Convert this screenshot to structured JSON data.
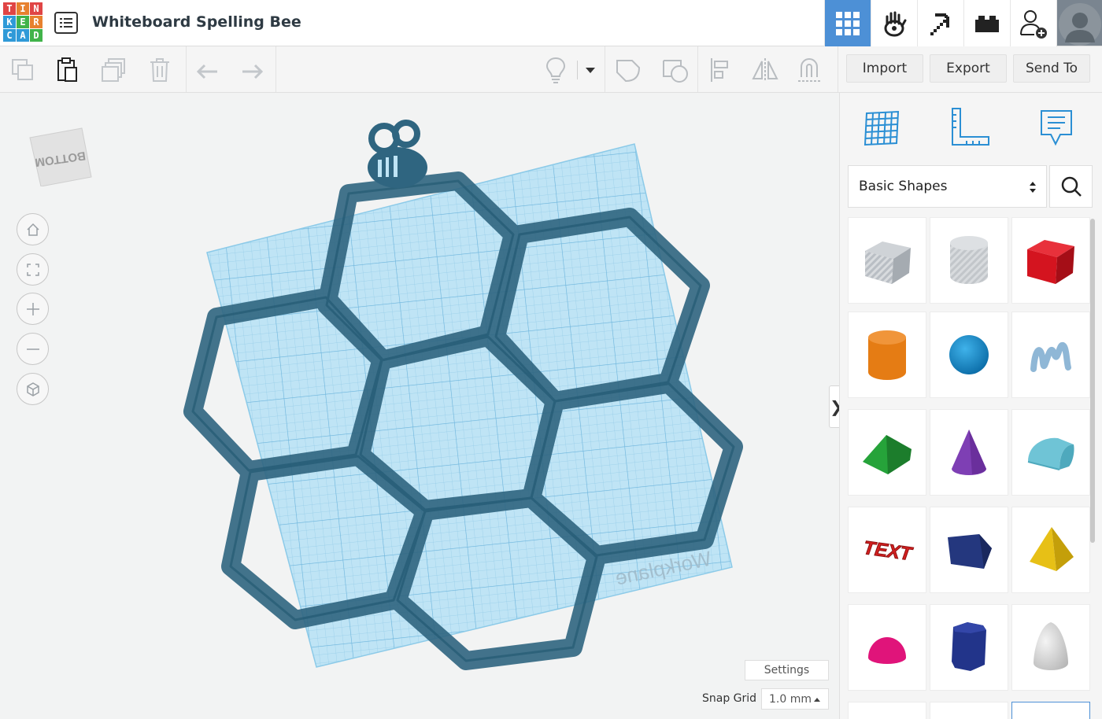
{
  "logo": {
    "letters": [
      "T",
      "I",
      "N",
      "K",
      "E",
      "R",
      "C",
      "A",
      "D"
    ]
  },
  "header": {
    "project_title": "Whiteboard Spelling Bee",
    "nav": [
      {
        "name": "3d-design",
        "icon": "grid-icon",
        "active": true
      },
      {
        "name": "circuits",
        "icon": "hand-icon",
        "active": false
      },
      {
        "name": "minecraft",
        "icon": "pickaxe-icon",
        "active": false
      },
      {
        "name": "lego-bricks",
        "icon": "brick-icon",
        "active": false
      },
      {
        "name": "invite",
        "icon": "user-add-icon",
        "active": false
      }
    ]
  },
  "toolbar": {
    "import_label": "Import",
    "export_label": "Export",
    "send_to_label": "Send To"
  },
  "viewport": {
    "nav_cube_label": "BOTTOM",
    "workplane_label": "Workplane",
    "settings_label": "Settings",
    "snap_grid_label": "Snap Grid",
    "snap_grid_value": "1.0 mm",
    "collapse_label": "❯"
  },
  "panel": {
    "category": "Basic Shapes",
    "shapes": [
      {
        "name": "box-hole",
        "color": "#b9bec4"
      },
      {
        "name": "cylinder-hole",
        "color": "#c2c6ca"
      },
      {
        "name": "box",
        "color": "#d4141f"
      },
      {
        "name": "cylinder",
        "color": "#e57c14"
      },
      {
        "name": "sphere",
        "color": "#1587c9"
      },
      {
        "name": "scribble",
        "color": "#8fb7d6"
      },
      {
        "name": "roof",
        "color": "#26a33a"
      },
      {
        "name": "cone",
        "color": "#7e3fb4"
      },
      {
        "name": "round-roof",
        "color": "#6fc4d6"
      },
      {
        "name": "text",
        "color": "#d42020",
        "glyph": "TEXT"
      },
      {
        "name": "polygon",
        "color": "#24377e"
      },
      {
        "name": "pyramid",
        "color": "#e7c016"
      },
      {
        "name": "half-sphere",
        "color": "#e0147a"
      },
      {
        "name": "hexagonal-prism",
        "color": "#22348a"
      },
      {
        "name": "paraboloid",
        "color": "#d8d8d8"
      }
    ]
  },
  "colors": {
    "accent": "#4d90d6",
    "workplane": "#a9d8f0",
    "model": "#2e5f77"
  }
}
